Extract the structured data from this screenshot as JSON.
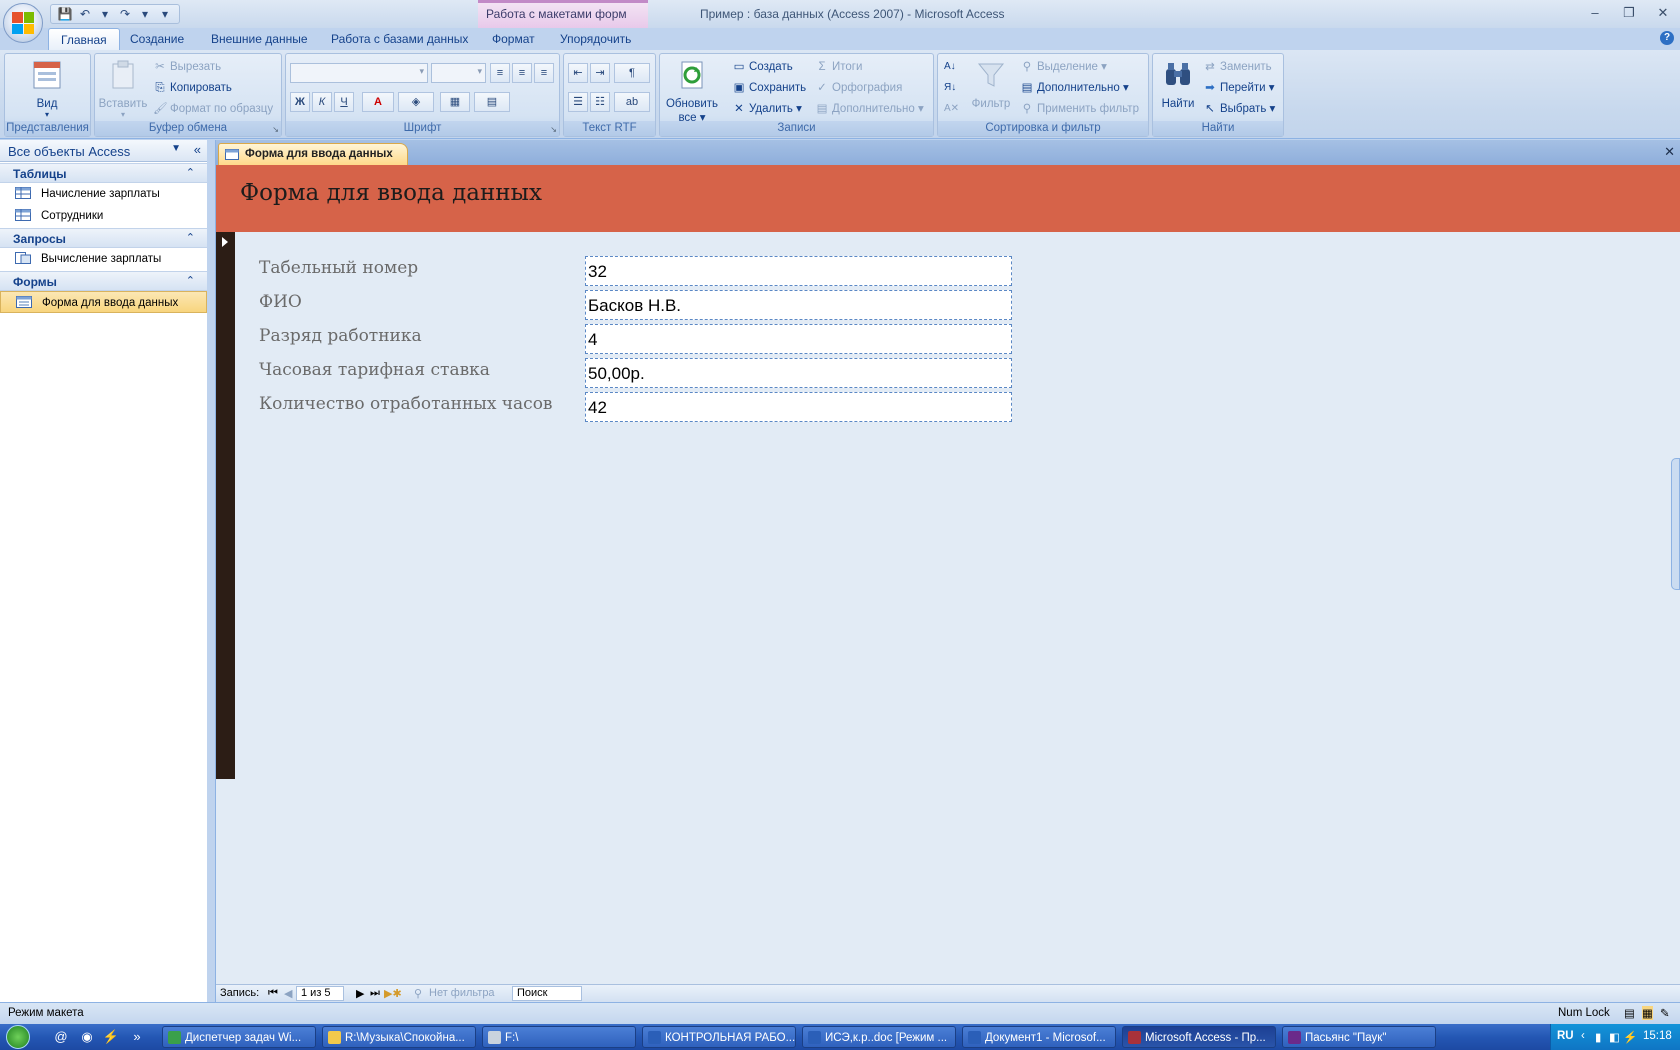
{
  "window": {
    "title": "Пример : база данных (Access 2007) - Microsoft Access",
    "context_tab_group": "Работа с макетами форм",
    "minimize": "‒",
    "maximize": "❐",
    "close": "✕"
  },
  "qat": [
    "💾",
    "↶",
    "▾",
    "↷",
    "▾",
    "▾"
  ],
  "ribbon_tabs": [
    {
      "label": "Главная",
      "active": true
    },
    {
      "label": "Создание"
    },
    {
      "label": "Внешние данные"
    },
    {
      "label": "Работа с базами данных"
    },
    {
      "label": "Формат"
    },
    {
      "label": "Упорядочить"
    }
  ],
  "help_label": "?",
  "ribbon": {
    "views": {
      "label": "Представления",
      "view_btn": "Вид"
    },
    "clipboard": {
      "label": "Буфер обмена",
      "paste": "Вставить",
      "cut": "Вырезать",
      "copy": "Копировать",
      "format_painter": "Формат по образцу"
    },
    "font": {
      "label": "Шрифт",
      "bold": "Ж",
      "italic": "К",
      "underline": "Ч",
      "font_color": "A"
    },
    "rtf": {
      "label": "Текст RTF"
    },
    "records": {
      "label": "Записи",
      "refresh": "Обновить",
      "refresh2": "все",
      "create": "Создать",
      "save": "Сохранить",
      "delete": "Удалить",
      "totals": "Итоги",
      "spelling": "Орфография",
      "more": "Дополнительно"
    },
    "sort_filter": {
      "label": "Сортировка и фильтр",
      "filter": "Фильтр",
      "selection": "Выделение",
      "advanced": "Дополнительно",
      "toggle_filter": "Применить фильтр"
    },
    "find": {
      "label": "Найти",
      "find_btn": "Найти",
      "replace": "Заменить",
      "goto": "Перейти",
      "select": "Выбрать"
    }
  },
  "nav_pane": {
    "header": "Все объекты Access",
    "groups": [
      {
        "label": "Таблицы",
        "items": [
          "Начисление зарплаты",
          "Сотрудники"
        ]
      },
      {
        "label": "Запросы",
        "items": [
          "Вычисление зарплаты"
        ]
      },
      {
        "label": "Формы",
        "items": [
          "Форма для ввода данных"
        ]
      }
    ]
  },
  "document": {
    "tab_label": "Форма для ввода данных",
    "form_title": "Форма для ввода данных",
    "fields": [
      {
        "label": "Табельный номер",
        "value": "32"
      },
      {
        "label": "ФИО",
        "value": "Басков Н.В."
      },
      {
        "label": "Разряд работника",
        "value": "4"
      },
      {
        "label": "Часовая тарифная ставка",
        "value": "50,00р."
      },
      {
        "label": "Количество отработанных часов",
        "value": "42"
      }
    ]
  },
  "record_nav": {
    "label": "Запись:",
    "position": "1 из 5",
    "filter": "Нет фильтра",
    "search": "Поиск"
  },
  "status_bar": {
    "mode": "Режим макета",
    "num_lock": "Num Lock"
  },
  "taskbar": {
    "tasks": [
      {
        "label": "Диспетчер задач Wi...",
        "color": "#3aa04a"
      },
      {
        "label": "R:\\Музыка\\Спокойна...",
        "color": "#f2c94c"
      },
      {
        "label": "F:\\",
        "color": "#c9d3de"
      },
      {
        "label": "КОНТРОЛЬНАЯ РАБО...",
        "color": "#2b5fb8"
      },
      {
        "label": "ИСЭ,к.р..doc [Режим ...",
        "color": "#2b5fb8"
      },
      {
        "label": "Документ1 - Microsof...",
        "color": "#2b5fb8"
      },
      {
        "label": "Microsoft Access - Пр...",
        "color": "#a8323a",
        "active": true
      },
      {
        "label": "Пасьянс \"Паук\"",
        "color": "#6b2a8a"
      }
    ],
    "lang": "RU",
    "time": "15:18"
  },
  "colors": {
    "form_header": "#d66349",
    "form_body": "#e2ebf5",
    "ribbon": "#c7d8ed"
  }
}
